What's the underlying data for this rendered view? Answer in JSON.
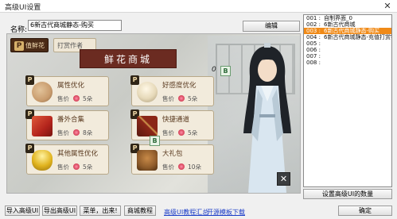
{
  "window": {
    "title": "高级UI设置",
    "close_glyph": "✕"
  },
  "name_row": {
    "label": "名称:",
    "value": "6新古代商城静态-购买",
    "edit_label": "编辑"
  },
  "preview": {
    "tabs": [
      {
        "badge": "P",
        "label": "值鲜花"
      },
      {
        "label": "打赏作者"
      }
    ],
    "title": "鲜花商城",
    "count": "0",
    "badge_text": "B",
    "close_glyph": "✕",
    "items": [
      {
        "badge": "P",
        "name": "属性优化",
        "price_label": "售价",
        "price": "5朵",
        "thumb_color": "#c99c6e"
      },
      {
        "badge": "P",
        "name": "好感度优化",
        "price_label": "售价",
        "price": "5朵",
        "thumb_color": "#e6d9b9"
      },
      {
        "badge": "P",
        "name": "番外合集",
        "price_label": "售价",
        "price": "8朵",
        "thumb_color": "#b3241c"
      },
      {
        "badge": "P",
        "name": "快捷通道",
        "price_label": "售价",
        "price": "5朵",
        "thumb_color": "#8b2718"
      },
      {
        "badge": "P",
        "name": "其他属性优化",
        "price_label": "售价",
        "price": "5朵",
        "thumb_color": "#e0b31e"
      },
      {
        "badge": "P",
        "name": "大礼包",
        "price_label": "售价",
        "price": "10朵",
        "thumb_color": "#8e5b2a"
      }
    ]
  },
  "ui_list": {
    "rows": [
      {
        "num": "001 :",
        "label": "自制界面_0"
      },
      {
        "num": "002 :",
        "label": "6新古代商城"
      },
      {
        "num": "003 :",
        "label": "6新古代商城静态-购买",
        "selected": true
      },
      {
        "num": "004 :",
        "label": "6新古代商城静态-充值打赏锦"
      },
      {
        "num": "005 :",
        "label": ""
      },
      {
        "num": "006 :",
        "label": ""
      },
      {
        "num": "007 :",
        "label": ""
      },
      {
        "num": "008 :",
        "label": ""
      }
    ],
    "settings_button": "设置高级UI的数量"
  },
  "bottom": {
    "import": "导入高级UI",
    "export": "导出高级UI",
    "menu": "菜单，出来!",
    "mall": "商城教程",
    "tutorial_link": "高级UI教程汇总",
    "template_link": "开源模板下载",
    "ok": "确定"
  },
  "colors": {
    "accent": "#f08a17",
    "shop_title_bg": "#6b2b21",
    "link": "#1a3cc8"
  }
}
